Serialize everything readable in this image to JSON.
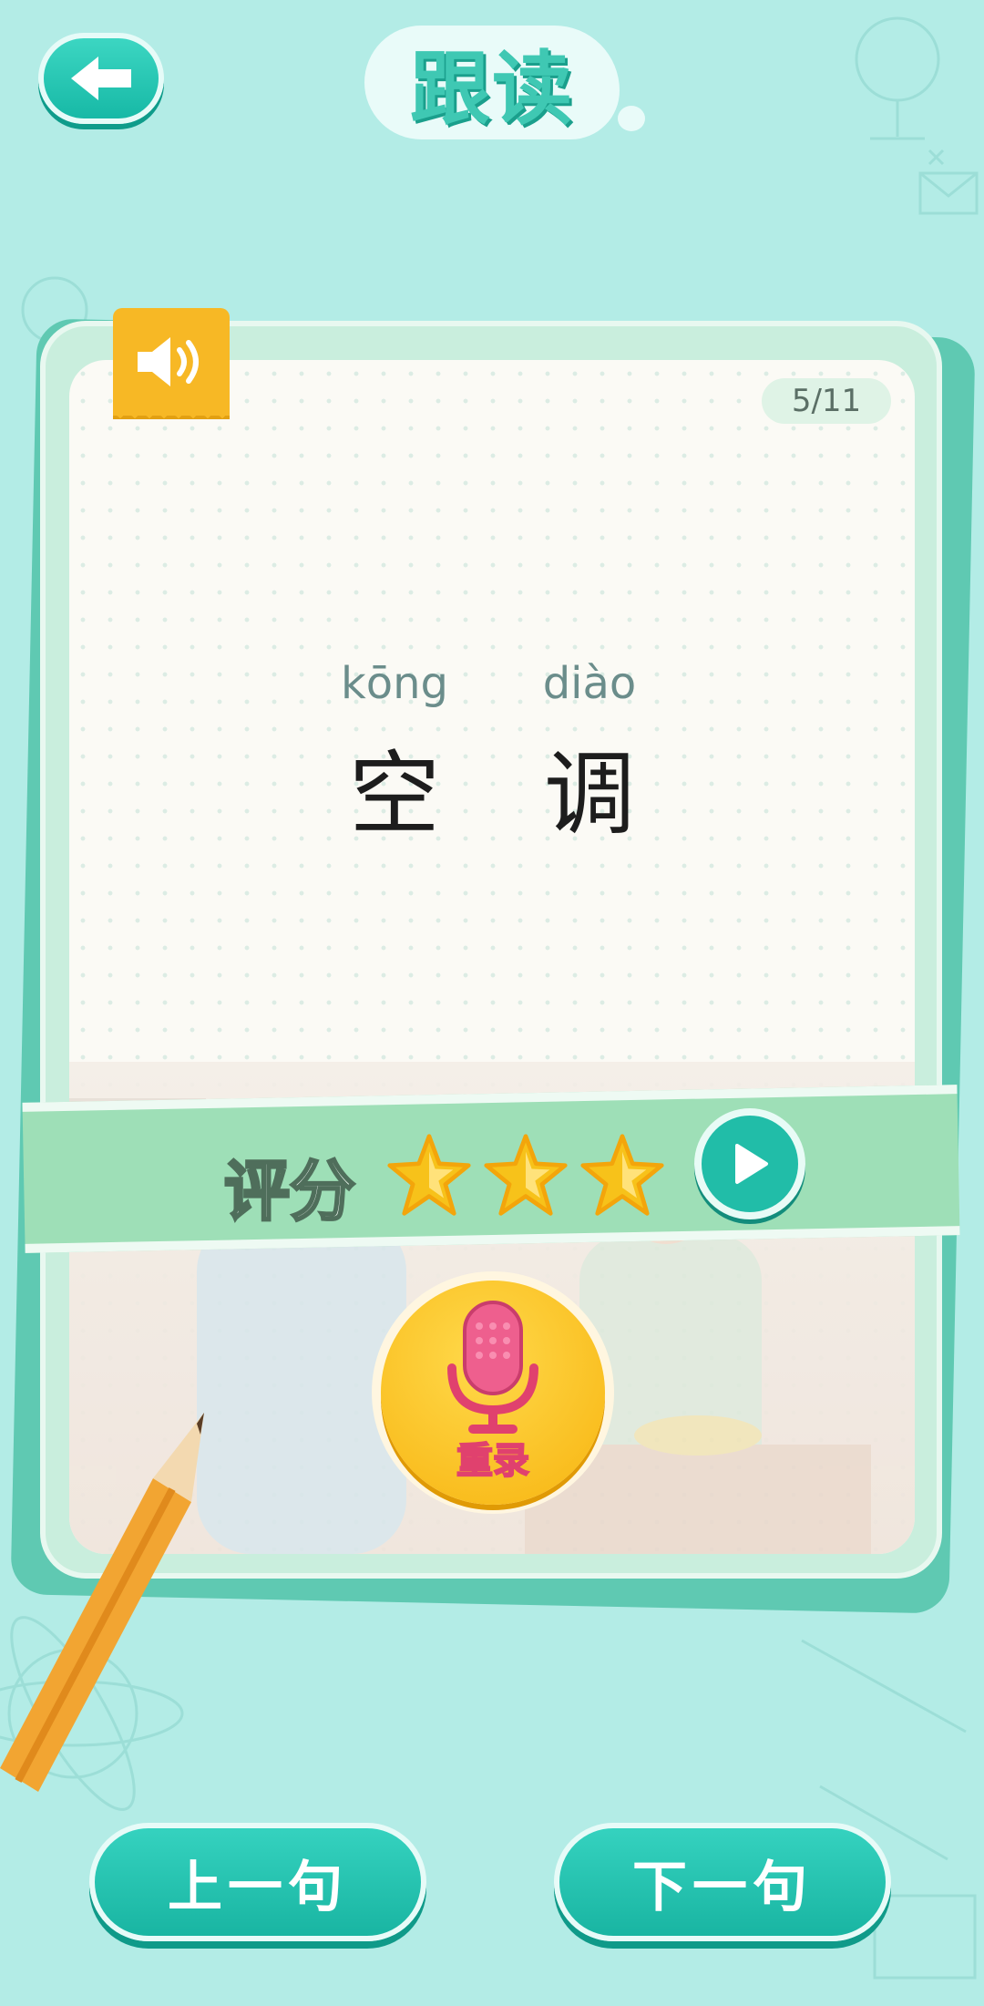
{
  "header": {
    "title": "跟读",
    "back_icon": "arrow-left-icon"
  },
  "card": {
    "counter": "5/11",
    "speaker_icon": "speaker-icon",
    "words": [
      {
        "pinyin": "kōng",
        "hanzi": "空"
      },
      {
        "pinyin": "diào",
        "hanzi": "调"
      }
    ]
  },
  "score": {
    "label": "评分",
    "stars": 3,
    "max_stars": 3,
    "play_icon": "play-icon"
  },
  "record": {
    "label": "重录",
    "icon": "microphone-icon"
  },
  "nav": {
    "prev_label": "上一句",
    "next_label": "下一句"
  },
  "colors": {
    "accent": "#21bda8",
    "background": "#b3ece6",
    "star": "#f7c21a",
    "mic": "#f7b410"
  }
}
